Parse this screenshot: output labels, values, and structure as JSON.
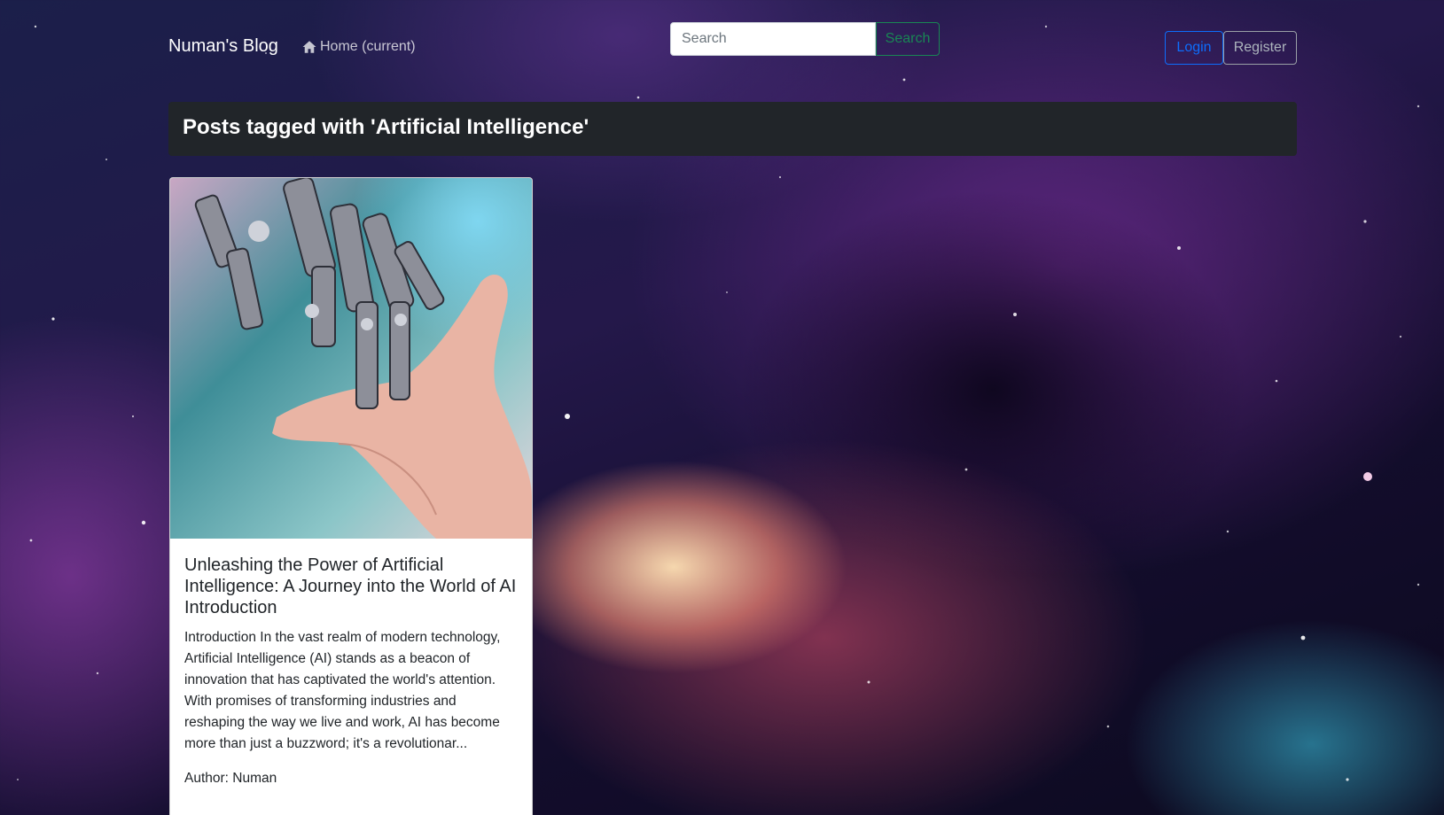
{
  "navbar": {
    "brand": "Numan's Blog",
    "home_label": "Home (current)",
    "search_placeholder": "Search",
    "search_button": "Search",
    "login_button": "Login",
    "register_button": "Register"
  },
  "page": {
    "heading": "Posts tagged with 'Artificial Intelligence'"
  },
  "posts": [
    {
      "image_alt": "Robot hand reaching toward human hand",
      "title": "Unleashing the Power of Artificial Intelligence: A Journey into the World of AI Introduction",
      "excerpt": "Introduction In the vast realm of modern technology, Artificial Intelligence (AI) stands as a beacon of innovation that has captivated the world's attention. With promises of transforming industries and reshaping the way we live and work, AI has become more than just a buzzword; it's a revolutionar...",
      "author": "Author: Numan"
    }
  ],
  "colors": {
    "primary": "#0d6efd",
    "success": "#198754",
    "dark": "#212529"
  },
  "icons": {
    "home": "home-icon"
  }
}
